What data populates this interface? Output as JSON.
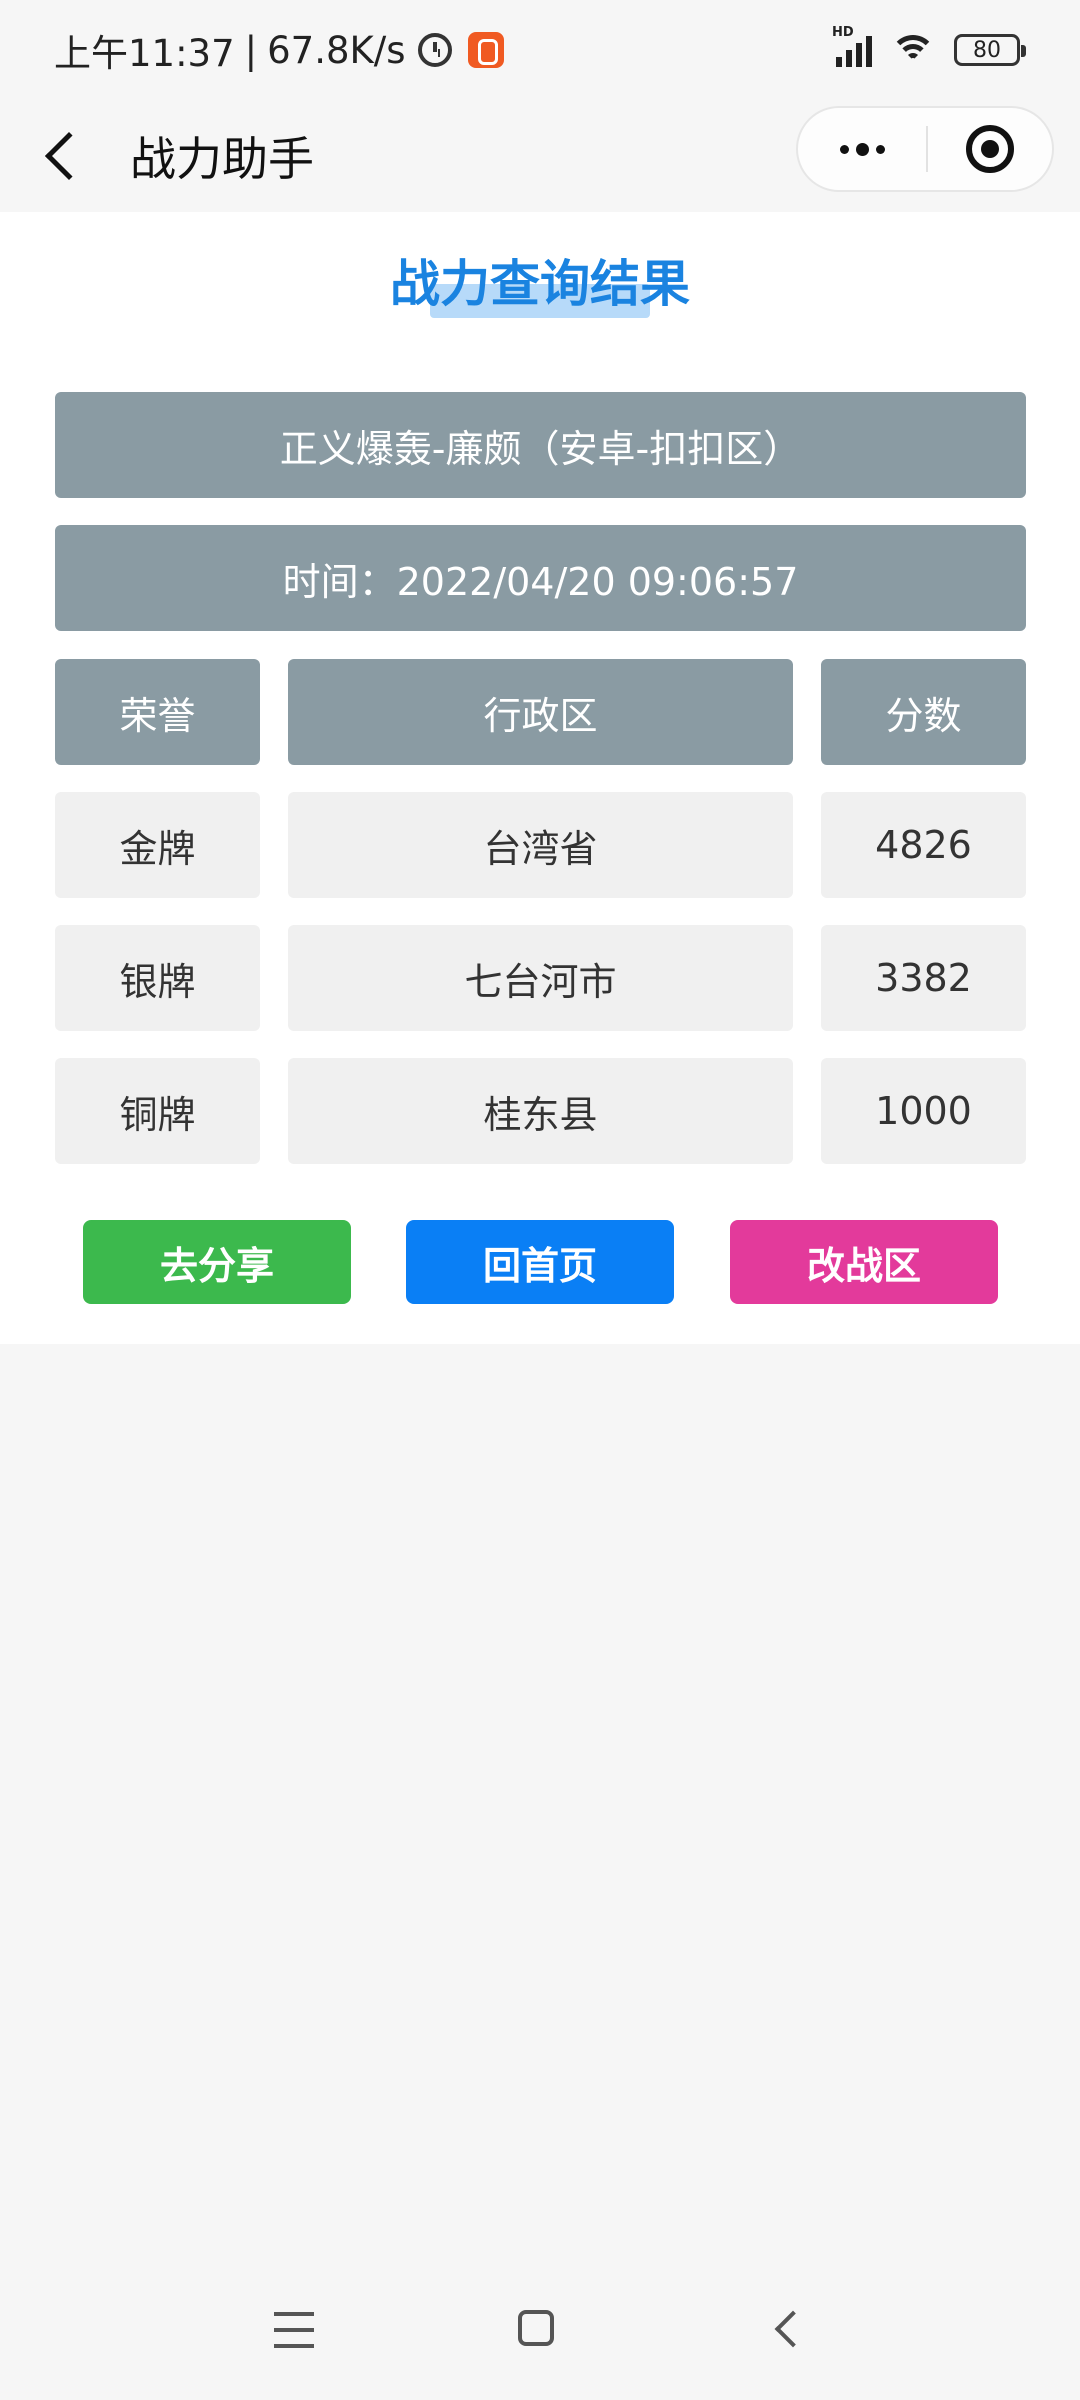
{
  "status_bar": {
    "time": "上午11:37",
    "separator": "|",
    "net_speed": "67.8K/s",
    "signal_label": "HD",
    "battery": "80"
  },
  "nav": {
    "title": "战力助手"
  },
  "result": {
    "title": "战力查询结果",
    "hero_info": "正义爆轰-廉颇（安卓-扣扣区）",
    "time_info": "时间：2022/04/20 09:06:57",
    "headers": [
      "荣誉",
      "行政区",
      "分数"
    ],
    "rows": [
      [
        "金牌",
        "台湾省",
        "4826"
      ],
      [
        "银牌",
        "七台河市",
        "3382"
      ],
      [
        "铜牌",
        "桂东县",
        "1000"
      ]
    ]
  },
  "buttons": {
    "share": "去分享",
    "home": "回首页",
    "change_zone": "改战区"
  },
  "colors": {
    "title": "#1a83e0",
    "header_cell": "#8a9ba3",
    "share_button": "#3cb94d",
    "home_button": "#0a7ff5",
    "change_button": "#e33a9b"
  }
}
